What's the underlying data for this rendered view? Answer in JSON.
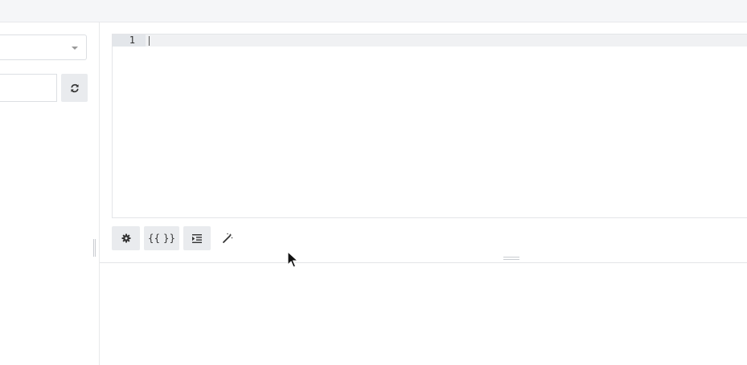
{
  "left_panel": {
    "select": {
      "value": ""
    },
    "text_input": {
      "value": "",
      "placeholder": ""
    },
    "refresh_button": {
      "icon": "refresh-icon"
    }
  },
  "editor": {
    "lines": [
      "1"
    ],
    "content": ""
  },
  "toolbar": {
    "settings_icon": "gear-icon",
    "braces_label": "{{ }}",
    "indent_icon": "indent-icon",
    "magic_icon": "magic-wand-icon"
  },
  "colors": {
    "topbar": "#f5f6f8",
    "button_bg": "#e9ebee",
    "active_line": "#f0f1f3",
    "border": "#e3e5e8"
  }
}
